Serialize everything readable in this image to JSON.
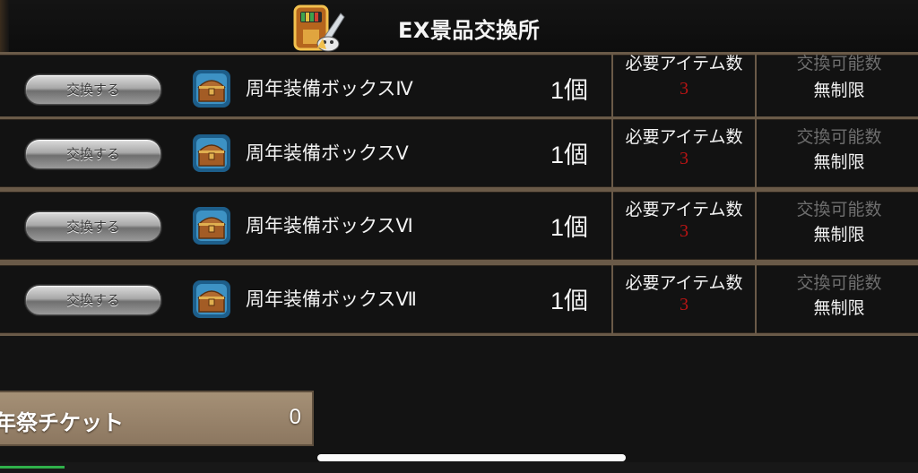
{
  "header": {
    "title": "EX景品交換所",
    "icon": "exchange-shop-icon"
  },
  "columns": {
    "exchange_button_label": "交換する",
    "required_label": "必要アイテム数",
    "limit_label": "交換可能数"
  },
  "items": [
    {
      "name": "周年装備ボックスⅣ",
      "qty": "1個",
      "required": "3",
      "limit": "無制限",
      "icon": "treasure-chest-icon"
    },
    {
      "name": "周年装備ボックスⅤ",
      "qty": "1個",
      "required": "3",
      "limit": "無制限",
      "icon": "treasure-chest-icon"
    },
    {
      "name": "周年装備ボックスⅥ",
      "qty": "1個",
      "required": "3",
      "limit": "無制限",
      "icon": "treasure-chest-icon"
    },
    {
      "name": "周年装備ボックスⅦ",
      "qty": "1個",
      "required": "3",
      "limit": "無制限",
      "icon": "treasure-chest-icon"
    }
  ],
  "ticket": {
    "label": "年祭チケット",
    "count": "0"
  },
  "colors": {
    "required_value": "#b81414",
    "limit_label": "#6e6e6e",
    "ticket_bg": "#a59076",
    "frame": "#6a5a48"
  }
}
